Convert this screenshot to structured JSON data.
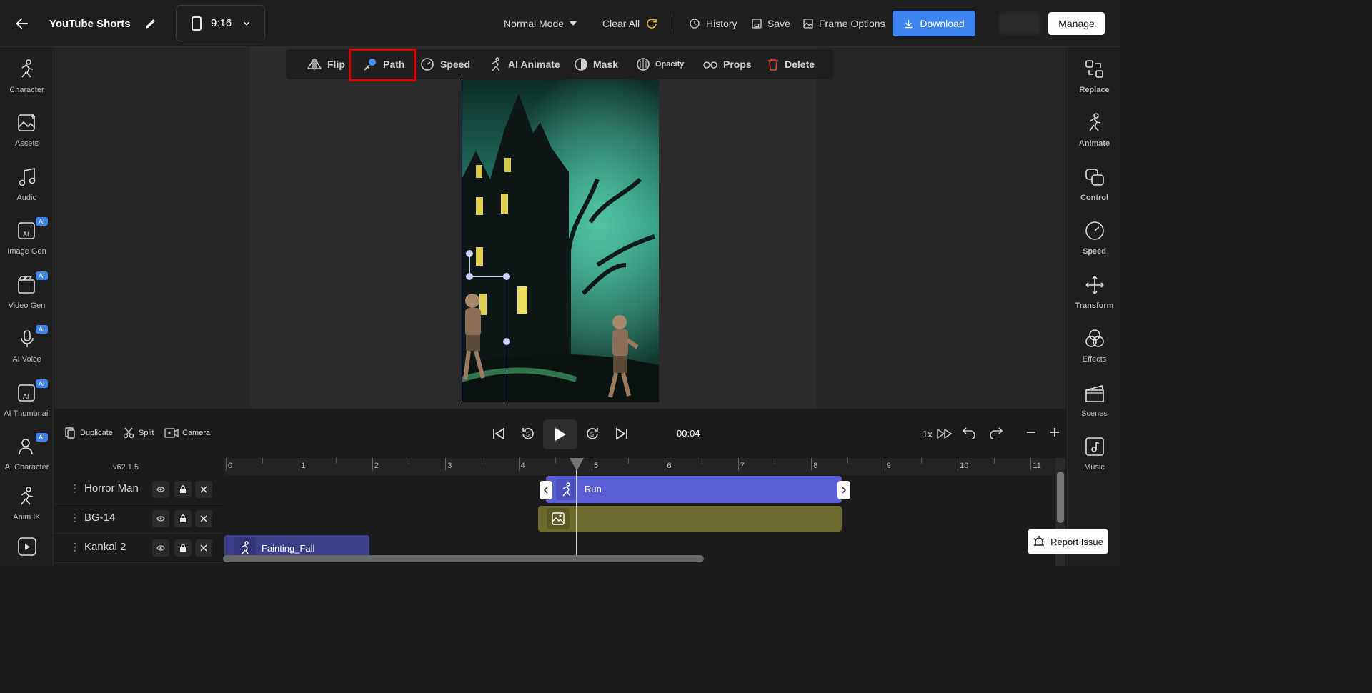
{
  "header": {
    "project_title": "YouTube Shorts",
    "aspect_ratio": "9:16",
    "mode": "Normal Mode",
    "clear_all": "Clear All",
    "history": "History",
    "save": "Save",
    "frame_options": "Frame Options",
    "download": "Download",
    "manage": "Manage"
  },
  "left_sidebar": {
    "items": [
      {
        "label": "Character",
        "icon": "character-icon"
      },
      {
        "label": "Assets",
        "icon": "assets-icon"
      },
      {
        "label": "Audio",
        "icon": "audio-icon"
      },
      {
        "label": "Image Gen",
        "icon": "image-gen-icon",
        "badge": "AI"
      },
      {
        "label": "Video Gen",
        "icon": "video-gen-icon",
        "badge": "AI"
      },
      {
        "label": "AI Voice",
        "icon": "ai-voice-icon",
        "badge": "AI"
      },
      {
        "label": "AI Thumbnail",
        "icon": "ai-thumbnail-icon",
        "badge": "AI"
      },
      {
        "label": "AI Character",
        "icon": "ai-character-icon",
        "badge": "AI"
      },
      {
        "label": "Anim IK",
        "icon": "anim-ik-icon"
      }
    ]
  },
  "right_sidebar": {
    "items": [
      {
        "label": "Replace",
        "icon": "replace-icon"
      },
      {
        "label": "Animate",
        "icon": "animate-icon"
      },
      {
        "label": "Control",
        "icon": "control-icon"
      },
      {
        "label": "Speed",
        "icon": "speed-icon"
      },
      {
        "label": "Transform",
        "icon": "transform-icon"
      },
      {
        "label": "Effects",
        "icon": "effects-icon"
      },
      {
        "label": "Scenes",
        "icon": "scenes-icon"
      },
      {
        "label": "Music",
        "icon": "music-icon"
      }
    ]
  },
  "object_toolbar": {
    "flip": "Flip",
    "path": "Path",
    "speed": "Speed",
    "ai_animate": "AI Animate",
    "mask": "Mask",
    "opacity": "Opacity",
    "props": "Props",
    "delete": "Delete"
  },
  "timeline": {
    "duplicate": "Duplicate",
    "split": "Split",
    "camera": "Camera",
    "current_time": "00:04",
    "playback_speed": "1x",
    "version": "v62.1.5",
    "ruler_ticks": [
      "0",
      "1",
      "2",
      "3",
      "4",
      "5",
      "6",
      "7",
      "8",
      "9",
      "10",
      "11"
    ],
    "layers": [
      {
        "name": "Horror Man",
        "clip": "Run"
      },
      {
        "name": "BG-14",
        "clip": ""
      },
      {
        "name": "Kankal 2",
        "clip": "Fainting_Fall"
      }
    ],
    "report_issue": "Report Issue"
  },
  "colors": {
    "accent": "#3d84f0",
    "run_clip": "#5b5fd6",
    "bg_clip": "#6b6a2c",
    "fall_clip": "#3e3f8a",
    "highlight": "#e00000"
  }
}
